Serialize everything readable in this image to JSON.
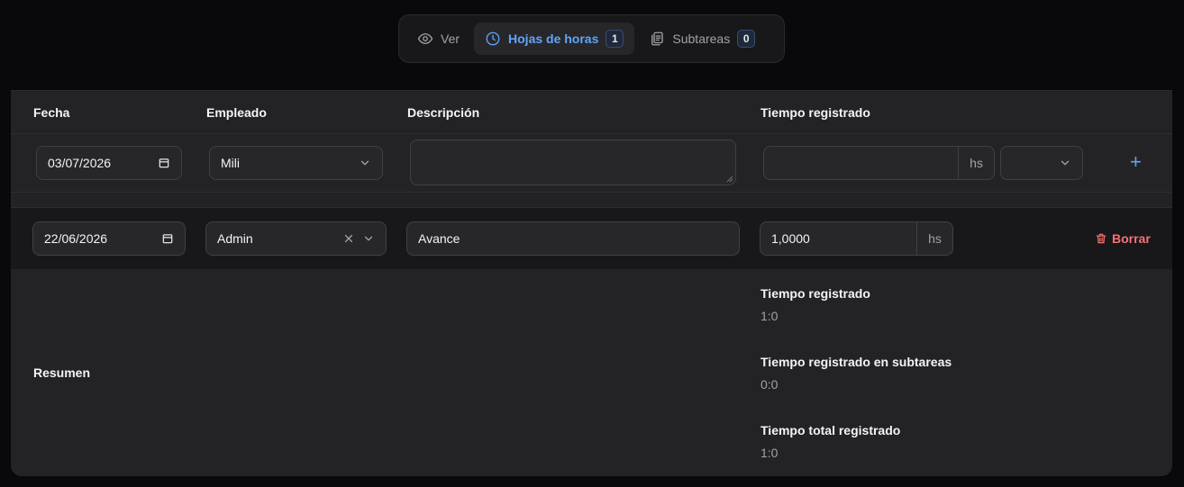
{
  "tabs": [
    {
      "label": "Ver",
      "icon": "eye-icon",
      "active": false
    },
    {
      "label": "Hojas de horas",
      "icon": "clock-icon",
      "count": "1",
      "active": true
    },
    {
      "label": "Subtareas",
      "icon": "clipboard-copy-icon",
      "count": "0",
      "active": false
    }
  ],
  "table": {
    "headers": {
      "date": "Fecha",
      "employee": "Empleado",
      "description": "Descripción",
      "time": "Tiempo registrado"
    },
    "new_row": {
      "date": "03/07/2026",
      "employee": "Mili",
      "description": "",
      "time": "",
      "unit": "hs",
      "add_label": "+"
    },
    "entries": [
      {
        "date": "22/06/2026",
        "employee": "Admin",
        "description": "Avance",
        "time": "1,0000",
        "unit": "hs",
        "delete_label": "Borrar"
      }
    ]
  },
  "summary": {
    "label": "Resumen",
    "stats": [
      {
        "title": "Tiempo registrado",
        "value": "1:0"
      },
      {
        "title": "Tiempo registrado en subtareas",
        "value": "0:0"
      },
      {
        "title": "Tiempo total registrado",
        "value": "1:0"
      }
    ]
  },
  "colors": {
    "accent": "#60a5fa",
    "danger": "#f87171",
    "background": "#09090b",
    "panel": "#232326"
  }
}
